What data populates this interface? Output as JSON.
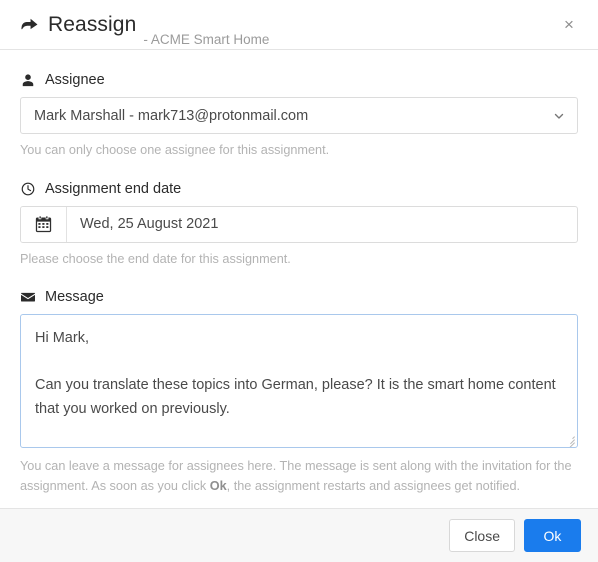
{
  "header": {
    "icon": "arrow-forward-icon",
    "title": "Reassign",
    "subtitle": "- ACME Smart Home",
    "close_icon": "close-icon",
    "close_label": "×"
  },
  "assignee": {
    "icon": "user-icon",
    "label": "Assignee",
    "value": "Mark Marshall - mark713@protonmail.com",
    "chevron_icon": "chevron-down-icon",
    "helper": "You can only choose one assignee for this assignment."
  },
  "end_date": {
    "icon": "clock-icon",
    "label": "Assignment end date",
    "calendar_icon": "calendar-icon",
    "value": "Wed, 25 August 2021",
    "helper": "Please choose the end date for this assignment."
  },
  "message": {
    "icon": "envelope-icon",
    "label": "Message",
    "value": "Hi Mark,\n\nCan you translate these topics into German, please? It is the smart home content that you worked on previously.",
    "helper_part1": "You can leave a message for assignees here. The message is sent along with the invitation for the assignment. As soon as you click ",
    "helper_bold": "Ok",
    "helper_part2": ", the assignment restarts and assignees get notified."
  },
  "footer": {
    "close_label": "Close",
    "ok_label": "Ok"
  },
  "colors": {
    "primary": "#1a7ced",
    "focus_border": "#a9c8ec",
    "border": "#dcdcdc",
    "helper_text": "#b3b3b3",
    "footer_bg": "#f7f7f7"
  }
}
